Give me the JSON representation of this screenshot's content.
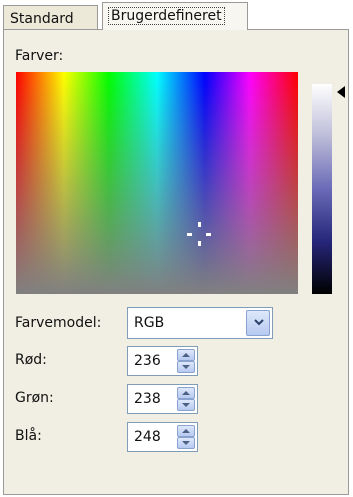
{
  "tabs": [
    {
      "label": "Standard"
    },
    {
      "label": "Brugerdefineret"
    }
  ],
  "colors_label": "Farver:",
  "color_model": {
    "label": "Farvemodel:",
    "value": "RGB"
  },
  "channels": {
    "red": {
      "label": "Rød:",
      "value": "236"
    },
    "green": {
      "label": "Grøn:",
      "value": "238"
    },
    "blue": {
      "label": "Blå:",
      "value": "248"
    }
  },
  "icons": {
    "dropdown": "chevron-down-icon",
    "spin_up": "arrow-up-icon",
    "spin_down": "arrow-down-icon",
    "luminance_marker": "triangle-left-icon",
    "picker": "crosshair-icon"
  },
  "colors": {
    "panel_bg": "#f1efe3",
    "control_border": "#7f9db9",
    "button_gradient_top": "#dfe8fb",
    "button_gradient_bottom": "#b6c9f0"
  }
}
